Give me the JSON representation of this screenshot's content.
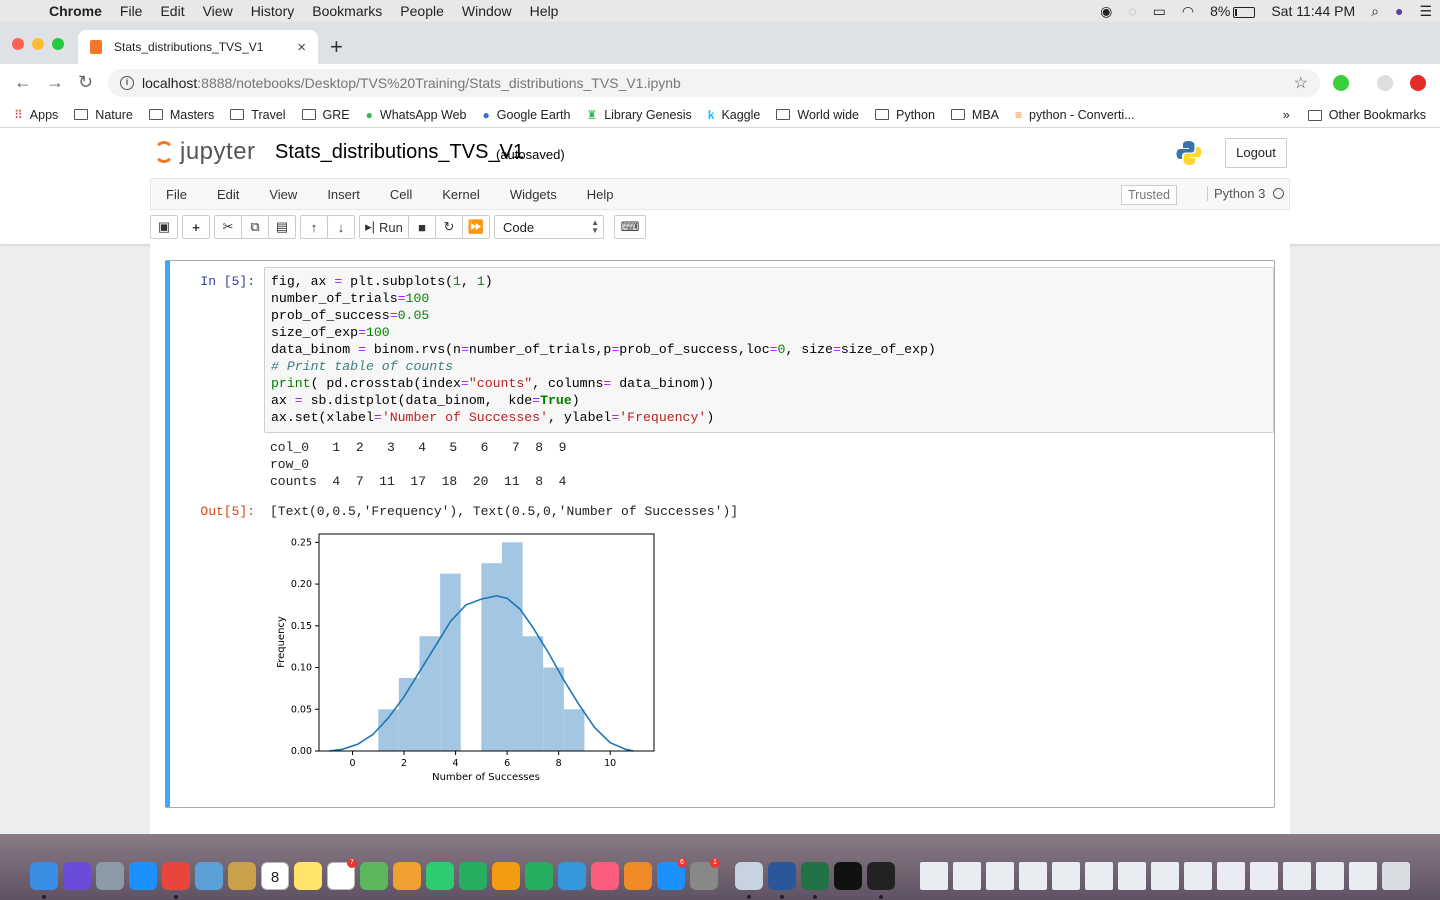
{
  "mac_menubar": {
    "app": "Chrome",
    "items": [
      "File",
      "Edit",
      "View",
      "History",
      "Bookmarks",
      "People",
      "Window",
      "Help"
    ],
    "battery": "8%",
    "clock": "Sat 11:44 PM"
  },
  "browser": {
    "tab_title": "Stats_distributions_TVS_V1",
    "url_host": "localhost",
    "url_path": ":8888/notebooks/Desktop/TVS%20Training/Stats_distributions_TVS_V1.ipynb",
    "bookmarks": [
      {
        "label": "Apps",
        "icon": "apps-grid-icon"
      },
      {
        "label": "Nature",
        "icon": "folder-icon"
      },
      {
        "label": "Masters",
        "icon": "folder-icon"
      },
      {
        "label": "Travel",
        "icon": "folder-icon"
      },
      {
        "label": "GRE",
        "icon": "folder-icon"
      },
      {
        "label": "WhatsApp Web",
        "icon": "whatsapp-icon"
      },
      {
        "label": "Google Earth",
        "icon": "google-earth-icon"
      },
      {
        "label": "Library Genesis",
        "icon": "library-icon"
      },
      {
        "label": "Kaggle",
        "icon": "kaggle-icon"
      },
      {
        "label": "World wide",
        "icon": "folder-icon"
      },
      {
        "label": "Python",
        "icon": "folder-icon"
      },
      {
        "label": "MBA",
        "icon": "folder-icon"
      },
      {
        "label": "python - Converti...",
        "icon": "stackoverflow-icon"
      }
    ],
    "overflow": "»",
    "other_bookmarks": "Other Bookmarks"
  },
  "jupyter": {
    "logo_text": "jupyter",
    "notebook_name": "Stats_distributions_TVS_V1",
    "autosave": "(autosaved)",
    "logout": "Logout",
    "menu": [
      "File",
      "Edit",
      "View",
      "Insert",
      "Cell",
      "Kernel",
      "Widgets",
      "Help"
    ],
    "trusted": "Trusted",
    "kernel": "Python 3",
    "run_label": "Run",
    "cell_type": "Code"
  },
  "cell": {
    "in_prompt": "In [5]:",
    "out_prompt": "Out[5]:",
    "crosstab_output": "col_0   1  2   3   4   5   6   7  8  9\nrow_0\ncounts  4  7  11  17  18  20  11  8  4",
    "out_text": "[Text(0,0.5,'Frequency'), Text(0.5,0,'Number of Successes')]"
  },
  "chart_data": {
    "type": "bar",
    "xlabel": "Number of Successes",
    "ylabel": "Frequency",
    "xlim": [
      -1.3,
      11.7
    ],
    "ylim": [
      0,
      0.26
    ],
    "xticks": [
      0,
      2,
      4,
      6,
      8,
      10
    ],
    "yticks": [
      0.0,
      0.05,
      0.1,
      0.15,
      0.2,
      0.25
    ],
    "ytick_labels": [
      "0.00",
      "0.05",
      "0.10",
      "0.15",
      "0.20",
      "0.25"
    ],
    "bars": [
      {
        "x0": 1.0,
        "x1": 1.8,
        "value": 0.05
      },
      {
        "x0": 1.8,
        "x1": 2.6,
        "value": 0.0875
      },
      {
        "x0": 2.6,
        "x1": 3.4,
        "value": 0.1375
      },
      {
        "x0": 3.4,
        "x1": 4.2,
        "value": 0.2125
      },
      {
        "x0": 5.0,
        "x1": 5.8,
        "value": 0.225
      },
      {
        "x0": 5.8,
        "x1": 6.6,
        "value": 0.25
      },
      {
        "x0": 6.6,
        "x1": 7.4,
        "value": 0.1375
      },
      {
        "x0": 7.4,
        "x1": 8.2,
        "value": 0.1
      },
      {
        "x0": 8.2,
        "x1": 9.0,
        "value": 0.05
      }
    ],
    "kde": {
      "x": [
        -0.9,
        -0.4,
        0.2,
        0.8,
        1.4,
        2.0,
        2.6,
        3.2,
        3.8,
        4.4,
        5.0,
        5.6,
        6.0,
        6.5,
        7.0,
        7.6,
        8.2,
        8.8,
        9.4,
        10.0,
        10.6,
        10.9
      ],
      "y": [
        0.0,
        0.002,
        0.008,
        0.02,
        0.04,
        0.065,
        0.095,
        0.125,
        0.155,
        0.175,
        0.182,
        0.186,
        0.183,
        0.17,
        0.148,
        0.118,
        0.085,
        0.055,
        0.028,
        0.01,
        0.002,
        0.0
      ]
    },
    "bar_color": "#a3c6e3",
    "line_color": "#1f77b4"
  },
  "dock": {
    "apps": [
      "finder-icon",
      "siri-icon",
      "launchpad-icon",
      "safari-icon",
      "chrome-icon",
      "preview-icon",
      "notefile-icon",
      "calendar-icon",
      "notes-icon",
      "reminders-icon",
      "maps-icon",
      "photos-icon",
      "messages-icon",
      "facetime-icon",
      "pages-icon",
      "numbers-icon",
      "keynote-icon",
      "itunes-icon",
      "books-icon",
      "appstore-icon",
      "system-preferences-icon",
      "mail-icon",
      "word-icon",
      "excel-icon",
      "spinner-icon",
      "terminal-icon"
    ],
    "calendar_day": "8",
    "reminders_badge": "7",
    "appstore_badge": "6",
    "sysprefs_badge": "1"
  }
}
